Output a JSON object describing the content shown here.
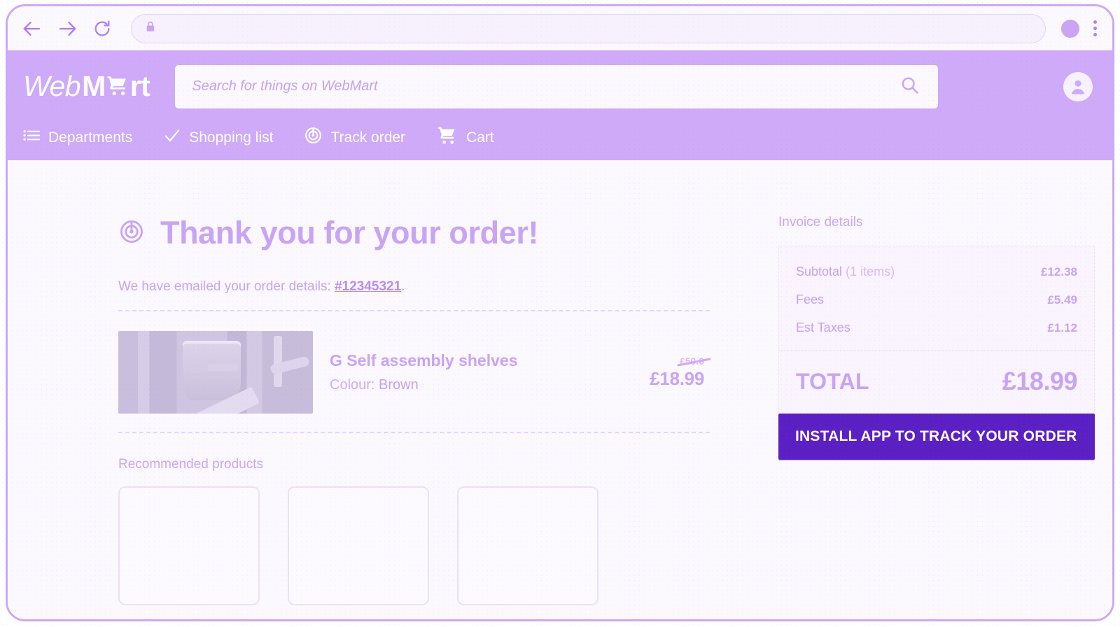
{
  "browser": {
    "back_icon": "back-arrow-icon",
    "forward_icon": "forward-arrow-icon",
    "reload_icon": "reload-icon",
    "lock_icon": "lock-icon",
    "url_value": "",
    "url_placeholder": "",
    "profile_icon": "profile-circle-icon",
    "menu_icon": "kebab-menu-icon"
  },
  "header": {
    "logo": {
      "part1": "Web",
      "part2": "M",
      "part3": "rt",
      "cart_icon": "shopping-cart-icon",
      "full_text": "WebMart"
    },
    "search": {
      "value": "",
      "placeholder": "Search for things on WebMart",
      "icon": "search-icon"
    },
    "account_icon": "account-avatar-icon",
    "nav": [
      {
        "label": "Departments",
        "icon": "list-menu-icon"
      },
      {
        "label": "Shopping list",
        "icon": "check-icon"
      },
      {
        "label": "Track order",
        "icon": "radar-target-icon"
      },
      {
        "label": "Cart",
        "icon": "shopping-cart-icon"
      }
    ]
  },
  "main": {
    "heading_icon": "radar-target-icon",
    "heading": "Thank you for your order!",
    "emailed_prefix": "We have emailed your order details: ",
    "order_number": "#12345321",
    "emailed_suffix": ".",
    "order_item": {
      "thumb_icon": "product-photo",
      "name": "G Self assembly shelves",
      "attr_label": "Colour:",
      "attr_value": "Brown",
      "old_price": "£50.0",
      "price": "£18.99"
    },
    "recommended_title": "Recommended products",
    "recommended_cards": [
      "",
      "",
      ""
    ]
  },
  "invoice": {
    "title": "Invoice details",
    "rows": [
      {
        "label": "Subtotal",
        "sub": "(1 items)",
        "value": "£12.38"
      },
      {
        "label": "Fees",
        "sub": "",
        "value": "£5.49"
      },
      {
        "label": "Est Taxes",
        "sub": "",
        "value": "£1.12"
      }
    ],
    "total_label": "TOTAL",
    "total_value": "£18.99",
    "cta_label": "INSTALL APP TO TRACK YOUR ORDER"
  },
  "colors": {
    "brand_purple": "#ceaaf9",
    "accent_text": "#c9a4f4",
    "cta_bg": "#5b20c3",
    "page_bg": "#fbf8fe",
    "frame_border": "#cda9f7"
  }
}
